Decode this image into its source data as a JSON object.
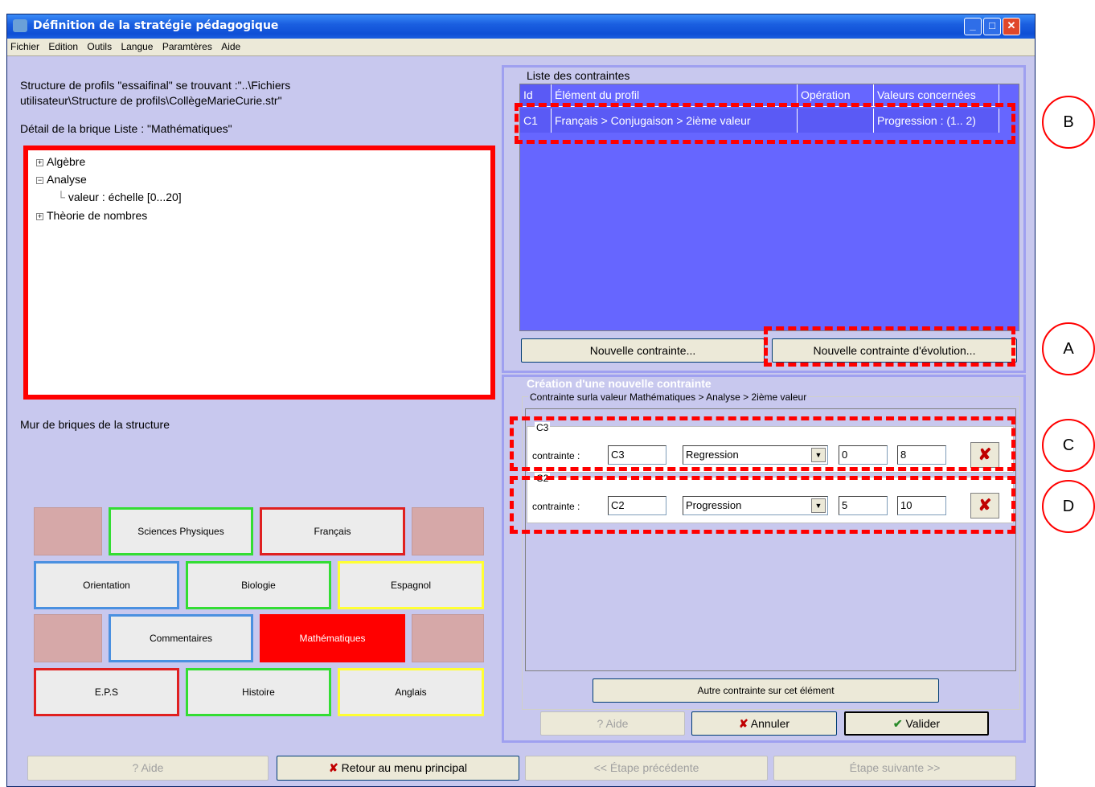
{
  "window": {
    "title": "Définition de la stratégie pédagogique"
  },
  "menu": [
    "Fichier",
    "Edition",
    "Outils",
    "Langue",
    "Paramtères",
    "Aide"
  ],
  "left": {
    "structure_line1": "Structure de profils \"essaifinal\" se trouvant :\"..\\Fichiers",
    "structure_line2": "utilisateur\\Structure de profils\\CollègeMarieCurie.str\"",
    "detail_label": "Détail de la brique Liste : \"Mathématiques\"",
    "tree": [
      {
        "label": "Algèbre",
        "expander": "+"
      },
      {
        "label": "Analyse",
        "expander": "−"
      },
      {
        "label": "valeur : échelle [0...20]",
        "expander": ""
      },
      {
        "label": "Thèorie de nombres",
        "expander": "+"
      }
    ],
    "wall_label": "Mur de briques de la structure",
    "bricks": {
      "sciences_physiques": "Sciences Physiques",
      "francais": "Français",
      "orientation": "Orientation",
      "biologie": "Biologie",
      "espagnol": "Espagnol",
      "commentaires": "Commentaires",
      "mathematiques": "Mathématiques",
      "eps": "E.P.S",
      "histoire": "Histoire",
      "anglais": "Anglais"
    }
  },
  "constraints_list": {
    "title": "Liste des contraintes",
    "headers": [
      "Id",
      "Élément du profil",
      "Opération",
      "Valeurs concernées"
    ],
    "rows": [
      {
        "id": "C1",
        "element": "Français > Conjugaison > 2ième valeur",
        "operation": "",
        "values": "Progression : (1.. 2)"
      }
    ],
    "new_button": "Nouvelle contrainte...",
    "new_evolution_button": "Nouvelle contrainte d'évolution..."
  },
  "creation": {
    "title": "Création d'une nouvelle contrainte",
    "group_label": "Contrainte surla valeur Mathématiques > Analyse > 2ième valeur",
    "rows": [
      {
        "legend": "C3",
        "label": "contrainte :",
        "name": "C3",
        "operation": "Regression",
        "min": "0",
        "max": "8"
      },
      {
        "legend": "C2",
        "label": "contrainte :",
        "name": "C2",
        "operation": "Progression",
        "min": "5",
        "max": "10"
      }
    ],
    "other_button": "Autre contrainte sur cet élément",
    "help_button": "Aide",
    "cancel_button": "Annuler",
    "validate_button": "Valider"
  },
  "bottom": {
    "help": "Aide",
    "back_menu": "Retour au menu principal",
    "prev": "<< Étape précédente",
    "next": "Étape suivante >>"
  },
  "annotations": [
    "A",
    "B",
    "C",
    "D"
  ],
  "colors": {
    "accent_red": "#ff0000",
    "grid_blue": "#6666ff",
    "panel_bg": "#c8c8ee"
  }
}
